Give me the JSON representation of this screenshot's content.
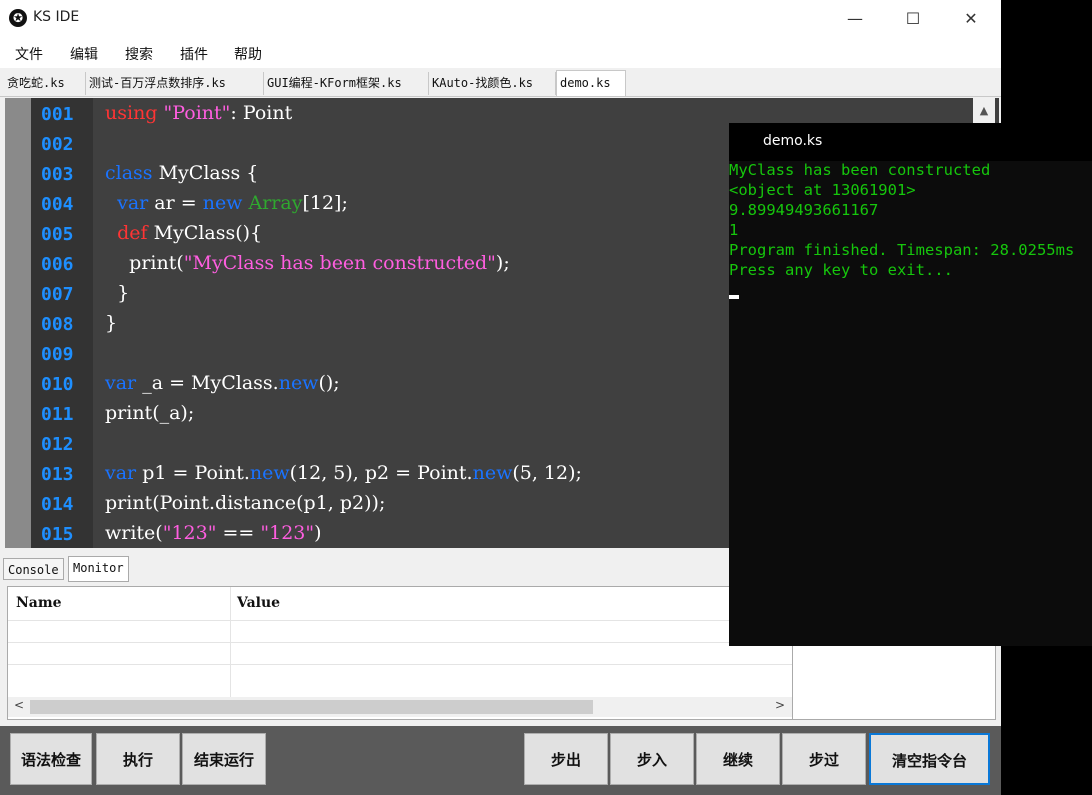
{
  "window": {
    "title": "KS IDE",
    "logo_glyph": "✪",
    "minimize": "—",
    "maximize": "☐",
    "close": "✕"
  },
  "menu": [
    "文件",
    "编辑",
    "搜索",
    "插件",
    "帮助"
  ],
  "file_tabs": [
    "贪吃蛇.ks",
    "测试-百万浮点数排序.ks",
    "GUI编程-KForm框架.ks",
    "KAuto-找颜色.ks",
    "demo.ks"
  ],
  "active_tab_index": 4,
  "editor": {
    "line_numbers": [
      "001",
      "002",
      "003",
      "004",
      "005",
      "006",
      "007",
      "008",
      "009",
      "010",
      "011",
      "012",
      "013",
      "014",
      "015"
    ],
    "code_lines": [
      [
        {
          "t": "using",
          "c": "kr"
        },
        {
          "t": " "
        },
        {
          "t": "\"Point\"",
          "c": "st"
        },
        {
          "t": ": Point"
        }
      ],
      [],
      [
        {
          "t": "class",
          "c": "kw"
        },
        {
          "t": " MyClass {"
        }
      ],
      [
        {
          "t": "  "
        },
        {
          "t": "var",
          "c": "kw"
        },
        {
          "t": " ar = "
        },
        {
          "t": "new",
          "c": "kw"
        },
        {
          "t": " "
        },
        {
          "t": "Array",
          "c": "kg"
        },
        {
          "t": "[12];"
        }
      ],
      [
        {
          "t": "  "
        },
        {
          "t": "def",
          "c": "kr"
        },
        {
          "t": " MyClass(){"
        }
      ],
      [
        {
          "t": "    print("
        },
        {
          "t": "\"MyClass has been constructed\"",
          "c": "st"
        },
        {
          "t": ");"
        }
      ],
      [
        {
          "t": "  }"
        }
      ],
      [
        {
          "t": "}"
        }
      ],
      [],
      [
        {
          "t": "var",
          "c": "kw"
        },
        {
          "t": " _a = MyClass."
        },
        {
          "t": "new",
          "c": "kw"
        },
        {
          "t": "();"
        }
      ],
      [
        {
          "t": "print(_a);"
        }
      ],
      [],
      [
        {
          "t": "var",
          "c": "kw"
        },
        {
          "t": " p1 = Point."
        },
        {
          "t": "new",
          "c": "kw"
        },
        {
          "t": "(12, 5), p2 = Point."
        },
        {
          "t": "new",
          "c": "kw"
        },
        {
          "t": "(5, 12);"
        }
      ],
      [
        {
          "t": "print(Point.distance(p1, p2));"
        }
      ],
      [
        {
          "t": "write("
        },
        {
          "t": "\"123\"",
          "c": "st"
        },
        {
          "t": " == "
        },
        {
          "t": "\"123\"",
          "c": "st"
        },
        {
          "t": ")"
        }
      ]
    ]
  },
  "bottom_tabs": [
    "Console",
    "Monitor"
  ],
  "active_bottom_tab": 1,
  "monitor": {
    "col_name": "Name",
    "col_value": "Value"
  },
  "buttons": {
    "syntax_check": "语法检查",
    "run": "执行",
    "stop": "结束运行",
    "step_out": "步出",
    "step_in": "步入",
    "continue": "继续",
    "step_over": "步过",
    "clear_console": "清空指令台"
  },
  "console": {
    "title": "demo.ks",
    "lines": [
      "MyClass has been constructed",
      "<object at 13061901>",
      "9.89949493661167",
      "1",
      "Program finished. Timespan: 28.0255ms",
      "Press any key to exit..."
    ]
  },
  "colors": {
    "keyword_blue": "#1a73ff",
    "keyword_red": "#ff3434",
    "type_green": "#2fa82f",
    "string_pink": "#ff5ee0",
    "console_green": "#16c60c",
    "line_number_blue": "#1e8fff"
  }
}
